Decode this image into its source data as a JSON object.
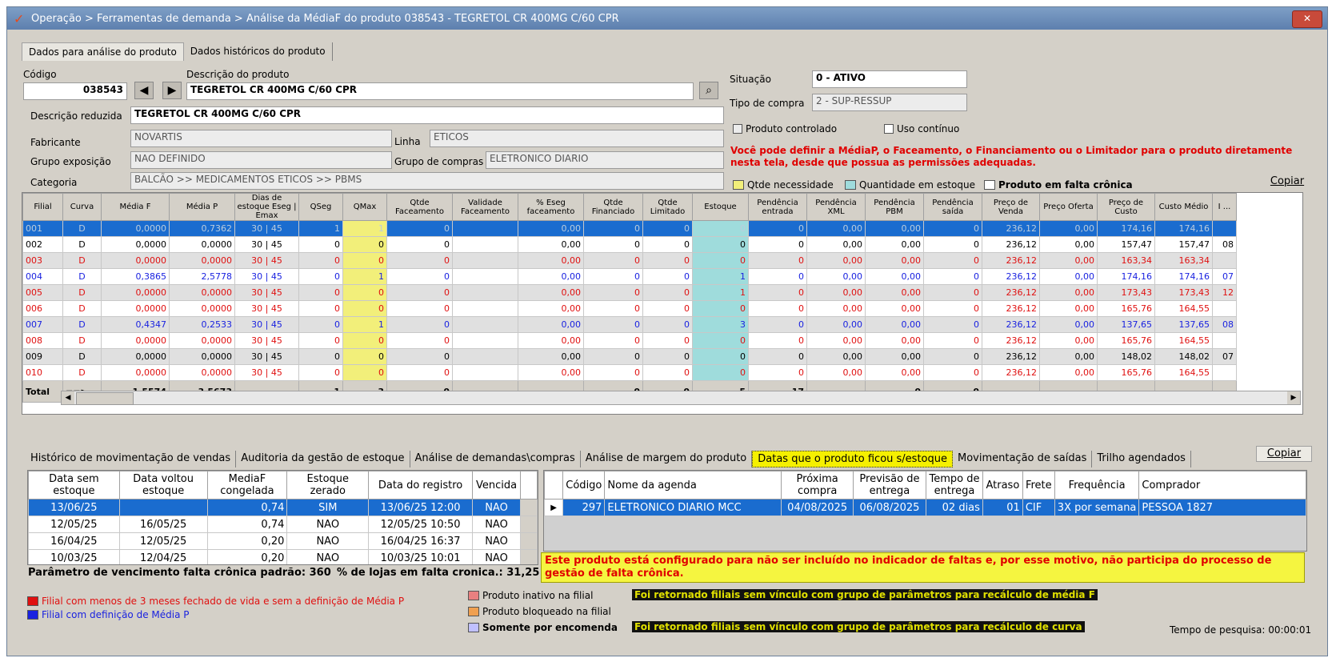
{
  "window": {
    "title": "Operação > Ferramentas de demanda > Análise da MédiaF do produto 038543 - TEGRETOL CR 400MG C/60 CPR",
    "close_label": "✕"
  },
  "top_tabs": [
    "Dados para análise do produto",
    "Dados históricos do produto"
  ],
  "product": {
    "codigo_label": "Código",
    "codigo": "038543",
    "descricao_label": "Descrição do produto",
    "descricao": "TEGRETOL CR 400MG C/60 CPR",
    "descricao_reduzida_label": "Descrição reduzida",
    "descricao_reduzida": "TEGRETOL CR 400MG C/60 CPR",
    "fabricante_label": "Fabricante",
    "fabricante": "NOVARTIS",
    "linha_label": "Linha",
    "linha": "ETICOS",
    "grupo_exposicao_label": "Grupo exposição",
    "grupo_exposicao": "NAO DEFINIDO",
    "grupo_compras_label": "Grupo de compras",
    "grupo_compras": "ELETRONICO DIARIO",
    "categoria_label": "Categoria",
    "categoria": "BALCÃO >> MEDICAMENTOS ETICOS >> PBMS",
    "situacao_label": "Situação",
    "situacao": "0 - ATIVO",
    "tipo_compra_label": "Tipo de compra",
    "tipo_compra": "2 - SUP-RESSUP",
    "produto_controlado_label": "Produto controlado",
    "uso_continuo_label": "Uso contínuo",
    "info_message": "Você pode definir a MédiaP, o Faceamento, o Financiamento ou o Limitador para o produto diretamente nesta tela, desde que possua as permissões adequadas."
  },
  "legend_top": {
    "qtde_necessidade": "Qtde necessidade",
    "qtde_estoque": "Quantidade em estoque",
    "falta_cronica": "Produto em falta crônica",
    "copiar": "Copiar"
  },
  "colors": {
    "selected": "#1a6ccf",
    "yellow": "#f2ef7a",
    "cyan": "#9fdcdc",
    "red": "#e01010",
    "blue": "#1a22e0"
  },
  "main_grid": {
    "headers": [
      "Filial",
      "Curva",
      "Média F",
      "Média P",
      "Dias de estoque Eseg | Emax",
      "QSeg",
      "QMax",
      "Qtde Faceamento",
      "Validade Faceamento",
      "% Eseg faceamento",
      "Qtde Financiado",
      "Qtde Limitado",
      "Estoque",
      "Pendência entrada",
      "Pendência XML",
      "Pendência PBM",
      "Pendência saída",
      "Preço de Venda",
      "Preço Oferta",
      "Preço de Custo",
      "Custo Médio",
      "I ..."
    ],
    "rows": [
      {
        "style": "sel",
        "cells": [
          "001",
          "D",
          "0,0000",
          "0,7362",
          "30 | 45",
          "1",
          "1",
          "0",
          "",
          "0,00",
          "0",
          "0",
          "0",
          "0",
          "0,00",
          "0,00",
          "0",
          "236,12",
          "0,00",
          "174,16",
          "174,16",
          ""
        ]
      },
      {
        "style": "",
        "cells": [
          "002",
          "D",
          "0,0000",
          "0,0000",
          "30 | 45",
          "0",
          "0",
          "0",
          "",
          "0,00",
          "0",
          "0",
          "0",
          "0",
          "0,00",
          "0,00",
          "0",
          "236,12",
          "0,00",
          "157,47",
          "157,47",
          "08"
        ]
      },
      {
        "style": "red gray",
        "cells": [
          "003",
          "D",
          "0,0000",
          "0,0000",
          "30 | 45",
          "0",
          "0",
          "0",
          "",
          "0,00",
          "0",
          "0",
          "0",
          "0",
          "0,00",
          "0,00",
          "0",
          "236,12",
          "0,00",
          "163,34",
          "163,34",
          ""
        ]
      },
      {
        "style": "blue",
        "cells": [
          "004",
          "D",
          "0,3865",
          "2,5778",
          "30 | 45",
          "0",
          "1",
          "0",
          "",
          "0,00",
          "0",
          "0",
          "1",
          "0",
          "0,00",
          "0,00",
          "0",
          "236,12",
          "0,00",
          "174,16",
          "174,16",
          "07"
        ]
      },
      {
        "style": "red gray",
        "cells": [
          "005",
          "D",
          "0,0000",
          "0,0000",
          "30 | 45",
          "0",
          "0",
          "0",
          "",
          "0,00",
          "0",
          "0",
          "1",
          "0",
          "0,00",
          "0,00",
          "0",
          "236,12",
          "0,00",
          "173,43",
          "173,43",
          "12"
        ]
      },
      {
        "style": "red",
        "cells": [
          "006",
          "D",
          "0,0000",
          "0,0000",
          "30 | 45",
          "0",
          "0",
          "0",
          "",
          "0,00",
          "0",
          "0",
          "0",
          "0",
          "0,00",
          "0,00",
          "0",
          "236,12",
          "0,00",
          "165,76",
          "164,55",
          ""
        ]
      },
      {
        "style": "blue gray",
        "cells": [
          "007",
          "D",
          "0,4347",
          "0,2533",
          "30 | 45",
          "0",
          "1",
          "0",
          "",
          "0,00",
          "0",
          "0",
          "3",
          "0",
          "0,00",
          "0,00",
          "0",
          "236,12",
          "0,00",
          "137,65",
          "137,65",
          "08"
        ]
      },
      {
        "style": "red",
        "cells": [
          "008",
          "D",
          "0,0000",
          "0,0000",
          "30 | 45",
          "0",
          "0",
          "0",
          "",
          "0,00",
          "0",
          "0",
          "0",
          "0",
          "0,00",
          "0,00",
          "0",
          "236,12",
          "0,00",
          "165,76",
          "164,55",
          ""
        ]
      },
      {
        "style": "gray",
        "cells": [
          "009",
          "D",
          "0,0000",
          "0,0000",
          "30 | 45",
          "0",
          "0",
          "0",
          "",
          "0,00",
          "0",
          "0",
          "0",
          "0",
          "0,00",
          "0,00",
          "0",
          "236,12",
          "0,00",
          "148,02",
          "148,02",
          "07"
        ]
      },
      {
        "style": "red",
        "cells": [
          "010",
          "D",
          "0,0000",
          "0,0000",
          "30 | 45",
          "0",
          "0",
          "0",
          "",
          "0,00",
          "0",
          "0",
          "0",
          "0",
          "0,00",
          "0,00",
          "0",
          "236,12",
          "0,00",
          "165,76",
          "164,55",
          ""
        ]
      }
    ],
    "total": [
      "Total",
      "==>",
      "1,5574",
      "3,5673",
      "",
      "1",
      "3",
      "0",
      "",
      "",
      "0",
      "0",
      "5",
      "17",
      "",
      "0",
      "0",
      "",
      "",
      "",
      "",
      ""
    ]
  },
  "bottom_tabs": [
    "Histórico de movimentação de vendas",
    "Auditoria da gestão de estoque",
    "Análise de demandas\\compras",
    "Análise de margem do produto",
    "Datas que o produto ficou s/estoque",
    "Movimentação de saídas",
    "Trilho agendados"
  ],
  "bottom_copy": "Copiar",
  "stock_table": {
    "headers": [
      "Data sem estoque",
      "Data voltou estoque",
      "MediaF congelada",
      "Estoque zerado",
      "Data do registro",
      "Vencida"
    ],
    "rows": [
      [
        "13/06/25",
        "",
        "0,74",
        "SIM",
        "13/06/25 12:00",
        "NAO"
      ],
      [
        "12/05/25",
        "16/05/25",
        "0,74",
        "NAO",
        "12/05/25 10:50",
        "NAO"
      ],
      [
        "16/04/25",
        "12/05/25",
        "0,20",
        "NAO",
        "16/04/25 16:37",
        "NAO"
      ],
      [
        "10/03/25",
        "12/04/25",
        "0,20",
        "NAO",
        "10/03/25 10:01",
        "NAO"
      ]
    ],
    "param_label": "Parâmetro de vencimento falta crônica padrão: 360",
    "pct_label": "% de lojas em falta cronica.: 31,25"
  },
  "agenda_table": {
    "headers": [
      "Código",
      "Nome da agenda",
      "Próxima compra",
      "Previsão de entrega",
      "Tempo de entrega",
      "Atraso",
      "Frete",
      "Frequência",
      "Comprador"
    ],
    "rows": [
      [
        "297",
        "ELETRONICO DIARIO MCC",
        "04/08/2025",
        "06/08/2025",
        "02 dias",
        "01",
        "CIF",
        "3X por semana",
        "PESSOA 1827"
      ]
    ]
  },
  "warning": "Este produto está configurado para não ser incluído no indicador de faltas e, por esse motivo, não participa do processo de gestão de falta crônica.",
  "footer": {
    "legend_red": "Filial com menos de 3 meses fechado de vida e sem a definição de Média P",
    "legend_blue": "Filial com definição de Média P",
    "inativo": "Produto inativo na filial",
    "bloqueado": "Produto bloqueado na filial",
    "encomenda": "Somente por encomenda",
    "tag1": "Foi retornado filiais sem vínculo com grupo de parâmetros para recálculo de média F",
    "tag2": "Foi retornado filiais sem vínculo com grupo de parâmetros para recálculo de curva",
    "tempo": "Tempo de pesquisa: 00:00:01"
  }
}
